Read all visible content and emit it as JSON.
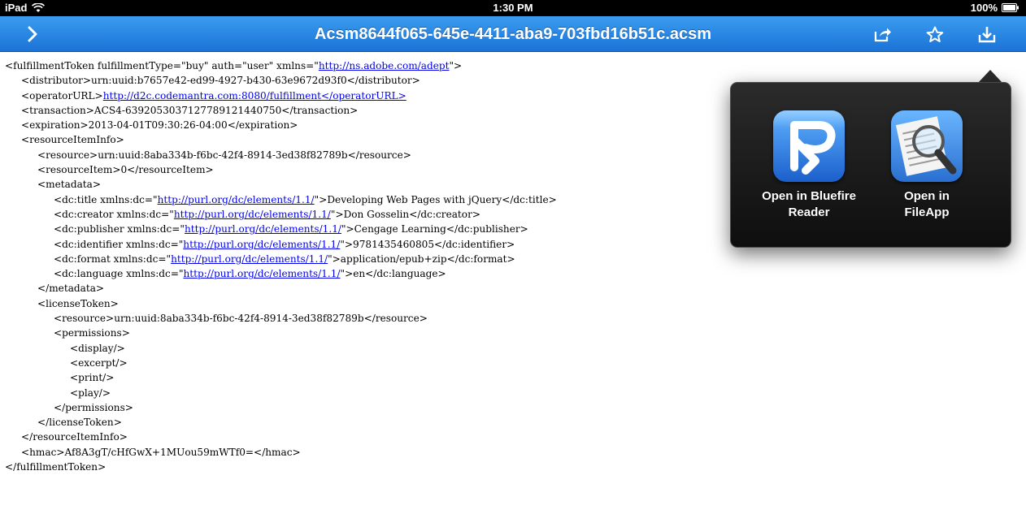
{
  "status_bar": {
    "device": "iPad",
    "time": "1:30 PM",
    "battery": "100%"
  },
  "nav_bar": {
    "title": "Acsm8644f065-645e-4411-aba9-703fbd16b51c.acsm",
    "back_icon": "chevron-right-icon",
    "share_icon": "share-icon",
    "bookmark_icon": "star-icon",
    "open_in_icon": "open-in-icon"
  },
  "document": {
    "lines": [
      {
        "indent": 0,
        "before": "<fulfillmentToken fulfillmentType=\"buy\" auth=\"user\" xmlns=\"",
        "link": "http://ns.adobe.com/adept",
        "after": "\">"
      },
      {
        "indent": 1,
        "text": "<distributor>urn:uuid:b7657e42-ed99-4927-b430-63e9672d93f0</distributor>"
      },
      {
        "indent": 1,
        "before": "<operatorURL>",
        "link": "http://d2c.codemantra.com:8080/fulfillment</operatorURL>",
        "after": ""
      },
      {
        "indent": 1,
        "text": "<transaction>ACS4-6392053037127789121440750</transaction>"
      },
      {
        "indent": 1,
        "text": "<expiration>2013-04-01T09:30:26-04:00</expiration>"
      },
      {
        "indent": 1,
        "text": "<resourceItemInfo>"
      },
      {
        "indent": 2,
        "text": "<resource>urn:uuid:8aba334b-f6bc-42f4-8914-3ed38f82789b</resource>"
      },
      {
        "indent": 2,
        "text": "<resourceItem>0</resourceItem>"
      },
      {
        "indent": 2,
        "text": "<metadata>"
      },
      {
        "indent": 3,
        "before": "<dc:title xmlns:dc=\"",
        "link": "http://purl.org/dc/elements/1.1/",
        "after": "\">Developing Web Pages with jQuery</dc:title>"
      },
      {
        "indent": 3,
        "before": "<dc:creator xmlns:dc=\"",
        "link": "http://purl.org/dc/elements/1.1/",
        "after": "\">Don Gosselin</dc:creator>"
      },
      {
        "indent": 3,
        "before": "<dc:publisher xmlns:dc=\"",
        "link": "http://purl.org/dc/elements/1.1/",
        "after": "\">Cengage Learning</dc:publisher>"
      },
      {
        "indent": 3,
        "before": "<dc:identifier xmlns:dc=\"",
        "link": "http://purl.org/dc/elements/1.1/",
        "after": "\">9781435460805</dc:identifier>"
      },
      {
        "indent": 3,
        "before": "<dc:format xmlns:dc=\"",
        "link": "http://purl.org/dc/elements/1.1/",
        "after": "\">application/epub+zip</dc:format>"
      },
      {
        "indent": 3,
        "before": "<dc:language xmlns:dc=\"",
        "link": "http://purl.org/dc/elements/1.1/",
        "after": "\">en</dc:language>"
      },
      {
        "indent": 2,
        "text": "</metadata>"
      },
      {
        "indent": 2,
        "text": "<licenseToken>"
      },
      {
        "indent": 3,
        "text": "<resource>urn:uuid:8aba334b-f6bc-42f4-8914-3ed38f82789b</resource>"
      },
      {
        "indent": 3,
        "text": "<permissions>"
      },
      {
        "indent": 4,
        "text": "<display/>"
      },
      {
        "indent": 4,
        "text": "<excerpt/>"
      },
      {
        "indent": 4,
        "text": "<print/>"
      },
      {
        "indent": 4,
        "text": "<play/>"
      },
      {
        "indent": 3,
        "text": "</permissions>"
      },
      {
        "indent": 2,
        "text": "</licenseToken>"
      },
      {
        "indent": 1,
        "text": "</resourceItemInfo>"
      },
      {
        "indent": 1,
        "text": "<hmac>Af8A3gT/cHfGwX+1MUou59mWTf0=</hmac>"
      },
      {
        "indent": 0,
        "text": "</fulfillmentToken>"
      }
    ]
  },
  "open_in_popover": {
    "apps": [
      {
        "label_line1": "Open in Bluefire",
        "label_line2": "Reader",
        "icon": "bluefire-reader-icon"
      },
      {
        "label_line1": "Open in",
        "label_line2": "FileApp",
        "icon": "fileapp-icon"
      }
    ]
  }
}
